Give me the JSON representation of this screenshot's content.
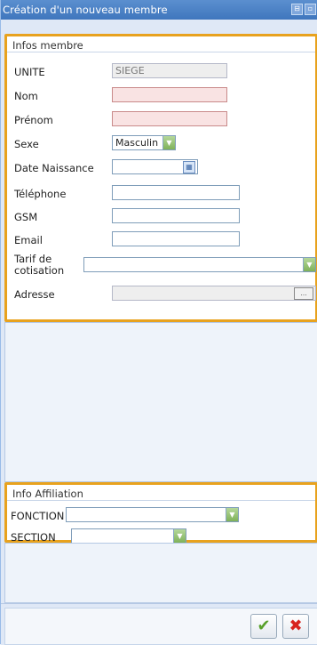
{
  "window": {
    "title": "Création d'un nouveau membre",
    "tools": [
      "⊟",
      "▫"
    ]
  },
  "membre": {
    "legend": "Infos membre",
    "unite": {
      "label": "UNITE",
      "value": "SIEGE"
    },
    "nom": {
      "label": "Nom",
      "value": ""
    },
    "prenom": {
      "label": "Prénom",
      "value": ""
    },
    "sexe": {
      "label": "Sexe",
      "value": "Masculin"
    },
    "date_naissance": {
      "label": "Date Naissance",
      "value": ""
    },
    "telephone": {
      "label": "Téléphone",
      "value": ""
    },
    "gsm": {
      "label": "GSM",
      "value": ""
    },
    "email": {
      "label": "Email",
      "value": ""
    },
    "tarif": {
      "label_line1": "Tarif de",
      "label_line2": "cotisation",
      "value": ""
    },
    "adresse": {
      "label": "Adresse",
      "value": "",
      "button": "…"
    }
  },
  "affiliation": {
    "legend": "Info Affiliation",
    "fonction": {
      "label": "FONCTION",
      "value": ""
    },
    "section": {
      "label": "SECTION",
      "value": ""
    }
  },
  "footer": {
    "ok_symbol": "✔",
    "cancel_symbol": "✖"
  },
  "colors": {
    "accent_border": "#e8a21e",
    "titlebar": "#3f76bd",
    "invalid_field": "#f9e3e3",
    "ok": "#58a02a",
    "cancel": "#d8231e"
  }
}
